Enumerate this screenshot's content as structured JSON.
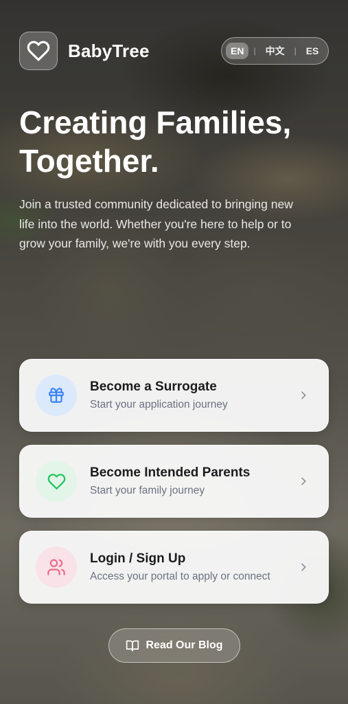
{
  "app": {
    "name": "BabyTree",
    "logo_icon": "heart-icon"
  },
  "language": {
    "options": [
      "EN",
      "中文",
      "ES"
    ],
    "selected": "EN"
  },
  "hero": {
    "title": "Creating Families, Together.",
    "subtitle": "Join a trusted community dedicated to bringing new life into the world. Whether you're here to help or to grow your family, we're with you every step."
  },
  "actions": [
    {
      "title": "Become a Surrogate",
      "subtitle": "Start your application journey",
      "icon": "gift-icon",
      "color": "#3b82f6",
      "bg": "#dbe9fb"
    },
    {
      "title": "Become Intended Parents",
      "subtitle": "Start your family journey",
      "icon": "heart-icon",
      "color": "#22c55e",
      "bg": "#e3f5e8"
    },
    {
      "title": "Login / Sign Up",
      "subtitle": "Access your portal to apply or connect",
      "icon": "users-icon",
      "color": "#ec6a8a",
      "bg": "#f9e2e8"
    }
  ],
  "blog": {
    "label": "Read Our Blog",
    "icon": "book-open-icon"
  }
}
